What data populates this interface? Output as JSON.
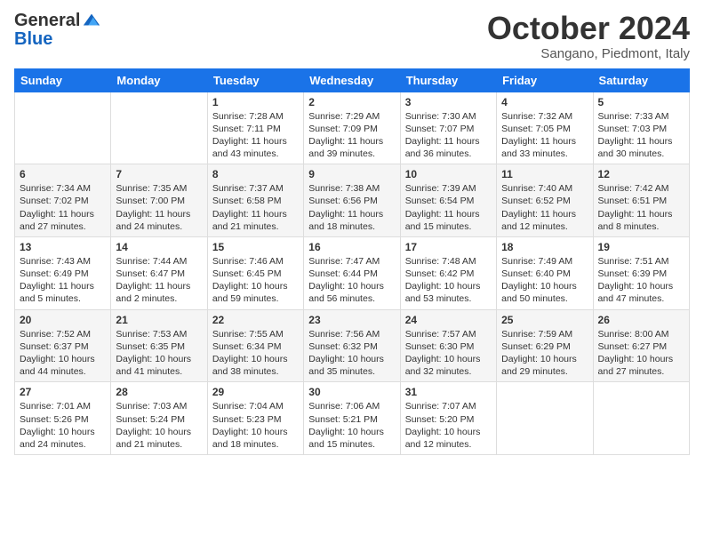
{
  "header": {
    "logo_general": "General",
    "logo_blue": "Blue",
    "month_title": "October 2024",
    "location": "Sangano, Piedmont, Italy"
  },
  "weekdays": [
    "Sunday",
    "Monday",
    "Tuesday",
    "Wednesday",
    "Thursday",
    "Friday",
    "Saturday"
  ],
  "weeks": [
    [
      {
        "day": "",
        "info": ""
      },
      {
        "day": "",
        "info": ""
      },
      {
        "day": "1",
        "info": "Sunrise: 7:28 AM\nSunset: 7:11 PM\nDaylight: 11 hours and 43 minutes."
      },
      {
        "day": "2",
        "info": "Sunrise: 7:29 AM\nSunset: 7:09 PM\nDaylight: 11 hours and 39 minutes."
      },
      {
        "day": "3",
        "info": "Sunrise: 7:30 AM\nSunset: 7:07 PM\nDaylight: 11 hours and 36 minutes."
      },
      {
        "day": "4",
        "info": "Sunrise: 7:32 AM\nSunset: 7:05 PM\nDaylight: 11 hours and 33 minutes."
      },
      {
        "day": "5",
        "info": "Sunrise: 7:33 AM\nSunset: 7:03 PM\nDaylight: 11 hours and 30 minutes."
      }
    ],
    [
      {
        "day": "6",
        "info": "Sunrise: 7:34 AM\nSunset: 7:02 PM\nDaylight: 11 hours and 27 minutes."
      },
      {
        "day": "7",
        "info": "Sunrise: 7:35 AM\nSunset: 7:00 PM\nDaylight: 11 hours and 24 minutes."
      },
      {
        "day": "8",
        "info": "Sunrise: 7:37 AM\nSunset: 6:58 PM\nDaylight: 11 hours and 21 minutes."
      },
      {
        "day": "9",
        "info": "Sunrise: 7:38 AM\nSunset: 6:56 PM\nDaylight: 11 hours and 18 minutes."
      },
      {
        "day": "10",
        "info": "Sunrise: 7:39 AM\nSunset: 6:54 PM\nDaylight: 11 hours and 15 minutes."
      },
      {
        "day": "11",
        "info": "Sunrise: 7:40 AM\nSunset: 6:52 PM\nDaylight: 11 hours and 12 minutes."
      },
      {
        "day": "12",
        "info": "Sunrise: 7:42 AM\nSunset: 6:51 PM\nDaylight: 11 hours and 8 minutes."
      }
    ],
    [
      {
        "day": "13",
        "info": "Sunrise: 7:43 AM\nSunset: 6:49 PM\nDaylight: 11 hours and 5 minutes."
      },
      {
        "day": "14",
        "info": "Sunrise: 7:44 AM\nSunset: 6:47 PM\nDaylight: 11 hours and 2 minutes."
      },
      {
        "day": "15",
        "info": "Sunrise: 7:46 AM\nSunset: 6:45 PM\nDaylight: 10 hours and 59 minutes."
      },
      {
        "day": "16",
        "info": "Sunrise: 7:47 AM\nSunset: 6:44 PM\nDaylight: 10 hours and 56 minutes."
      },
      {
        "day": "17",
        "info": "Sunrise: 7:48 AM\nSunset: 6:42 PM\nDaylight: 10 hours and 53 minutes."
      },
      {
        "day": "18",
        "info": "Sunrise: 7:49 AM\nSunset: 6:40 PM\nDaylight: 10 hours and 50 minutes."
      },
      {
        "day": "19",
        "info": "Sunrise: 7:51 AM\nSunset: 6:39 PM\nDaylight: 10 hours and 47 minutes."
      }
    ],
    [
      {
        "day": "20",
        "info": "Sunrise: 7:52 AM\nSunset: 6:37 PM\nDaylight: 10 hours and 44 minutes."
      },
      {
        "day": "21",
        "info": "Sunrise: 7:53 AM\nSunset: 6:35 PM\nDaylight: 10 hours and 41 minutes."
      },
      {
        "day": "22",
        "info": "Sunrise: 7:55 AM\nSunset: 6:34 PM\nDaylight: 10 hours and 38 minutes."
      },
      {
        "day": "23",
        "info": "Sunrise: 7:56 AM\nSunset: 6:32 PM\nDaylight: 10 hours and 35 minutes."
      },
      {
        "day": "24",
        "info": "Sunrise: 7:57 AM\nSunset: 6:30 PM\nDaylight: 10 hours and 32 minutes."
      },
      {
        "day": "25",
        "info": "Sunrise: 7:59 AM\nSunset: 6:29 PM\nDaylight: 10 hours and 29 minutes."
      },
      {
        "day": "26",
        "info": "Sunrise: 8:00 AM\nSunset: 6:27 PM\nDaylight: 10 hours and 27 minutes."
      }
    ],
    [
      {
        "day": "27",
        "info": "Sunrise: 7:01 AM\nSunset: 5:26 PM\nDaylight: 10 hours and 24 minutes."
      },
      {
        "day": "28",
        "info": "Sunrise: 7:03 AM\nSunset: 5:24 PM\nDaylight: 10 hours and 21 minutes."
      },
      {
        "day": "29",
        "info": "Sunrise: 7:04 AM\nSunset: 5:23 PM\nDaylight: 10 hours and 18 minutes."
      },
      {
        "day": "30",
        "info": "Sunrise: 7:06 AM\nSunset: 5:21 PM\nDaylight: 10 hours and 15 minutes."
      },
      {
        "day": "31",
        "info": "Sunrise: 7:07 AM\nSunset: 5:20 PM\nDaylight: 10 hours and 12 minutes."
      },
      {
        "day": "",
        "info": ""
      },
      {
        "day": "",
        "info": ""
      }
    ]
  ]
}
